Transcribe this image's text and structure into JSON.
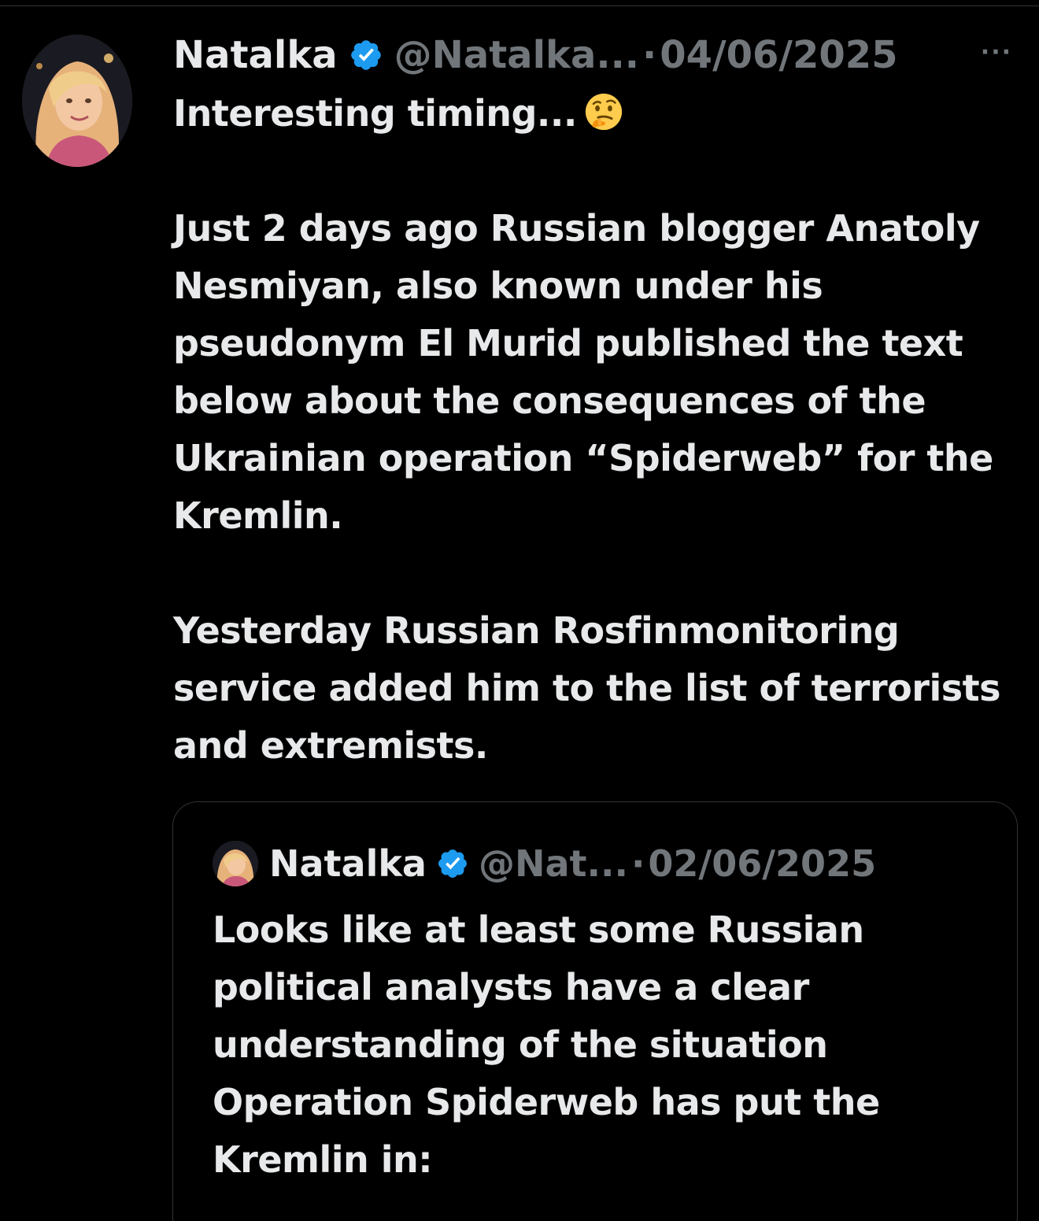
{
  "tweet": {
    "author_name": "Natalka",
    "handle": "@Natalka...",
    "separator": "·",
    "date": "04/06/2025",
    "more_label": "···",
    "paragraphs": [
      "Interesting timing...",
      "Just 2 days ago Russian blogger Anatoly Nesmiyan, also known under his pseudonym El Murid published the text below about the consequences of the Ukrainian operation “Spiderweb” for the Kremlin.",
      "Yesterday Russian Rosfinmonitoring service added him to the list of terrorists and extremists."
    ],
    "emoji": "thinking-face"
  },
  "quoted_tweet": {
    "author_name": "Natalka",
    "handle": "@Nat...",
    "separator": "·",
    "date": "02/06/2025",
    "text": "Looks like at least some Russian political analysts have a clear understanding of the situation Operation Spiderweb has put the Kremlin in:"
  },
  "colors": {
    "background": "#000000",
    "text": "#e7e9ea",
    "muted": "#71767b",
    "verified": "#1d9bf0",
    "border": "#2f3336"
  }
}
